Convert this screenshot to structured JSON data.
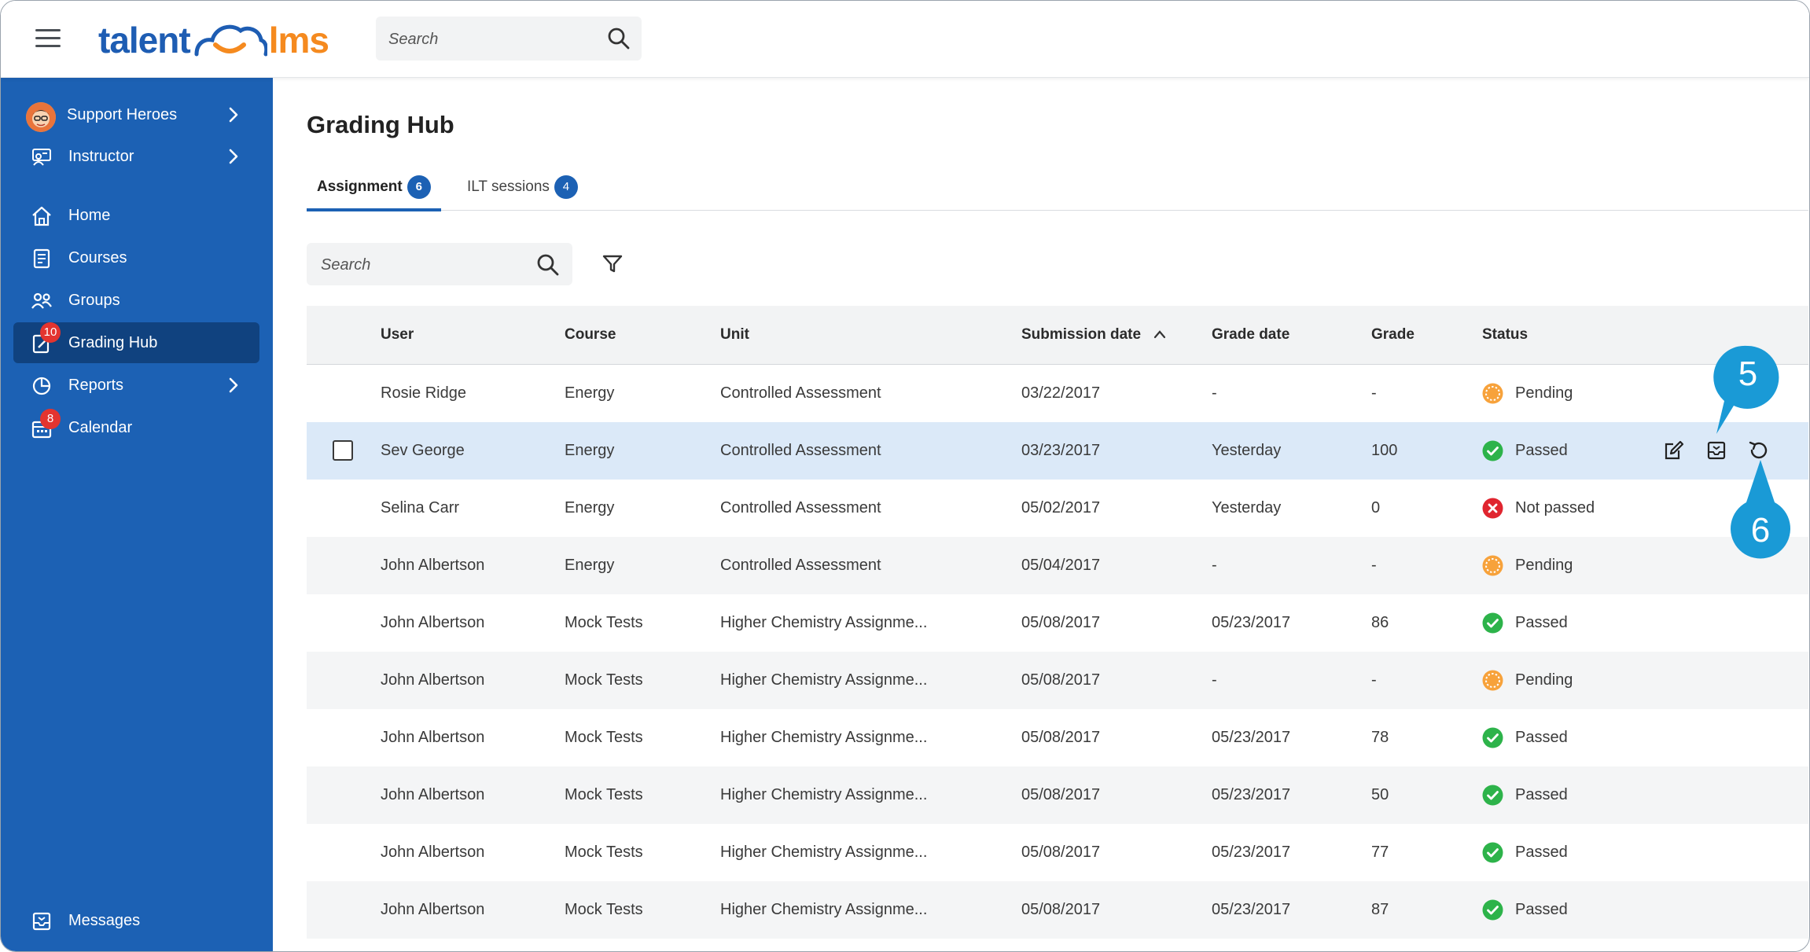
{
  "header": {
    "logo_part1": "talent",
    "logo_part2": "lms",
    "search_placeholder": "Search"
  },
  "sidebar": {
    "items": [
      {
        "label": "Support Heroes",
        "icon": "avatar",
        "chevron": true
      },
      {
        "label": "Instructor",
        "icon": "instructor-icon",
        "chevron": true
      },
      {
        "label": "Home",
        "icon": "home-icon"
      },
      {
        "label": "Courses",
        "icon": "courses-icon"
      },
      {
        "label": "Groups",
        "icon": "groups-icon"
      },
      {
        "label": "Grading Hub",
        "icon": "grading-hub-icon",
        "badge": "10",
        "active": true
      },
      {
        "label": "Reports",
        "icon": "reports-icon",
        "chevron": true
      },
      {
        "label": "Calendar",
        "icon": "calendar-icon",
        "badge": "8"
      }
    ],
    "footer": {
      "label": "Messages",
      "icon": "messages-icon"
    }
  },
  "page": {
    "title": "Grading Hub",
    "tabs": [
      {
        "label": "Assignment",
        "count": "6",
        "active": true
      },
      {
        "label": "ILT sessions",
        "count": "4",
        "active": false
      }
    ],
    "search_placeholder": "Search"
  },
  "table": {
    "columns": [
      "User",
      "Course",
      "Unit",
      "Submission date",
      "Grade date",
      "Grade",
      "Status"
    ],
    "sort_indicator": "Submission date ascending",
    "rows": [
      {
        "user": "Rosie Ridge",
        "course": "Energy",
        "unit": "Controlled Assessment",
        "submission": "03/22/2017",
        "grade_date": "-",
        "grade": "-",
        "status": "Pending"
      },
      {
        "user": "Sev George",
        "course": "Energy",
        "unit": "Controlled Assessment",
        "submission": "03/23/2017",
        "grade_date": "Yesterday",
        "grade": "100",
        "status": "Passed",
        "selected": true
      },
      {
        "user": "Selina Carr",
        "course": "Energy",
        "unit": "Controlled Assessment",
        "submission": "05/02/2017",
        "grade_date": "Yesterday",
        "grade": "0",
        "status": "Not passed"
      },
      {
        "user": "John Albertson",
        "course": "Energy",
        "unit": "Controlled Assessment",
        "submission": "05/04/2017",
        "grade_date": "-",
        "grade": "-",
        "status": "Pending"
      },
      {
        "user": "John Albertson",
        "course": "Mock Tests",
        "unit": "Higher Chemistry Assignme...",
        "submission": "05/08/2017",
        "grade_date": "05/23/2017",
        "grade": "86",
        "status": "Passed"
      },
      {
        "user": "John Albertson",
        "course": "Mock Tests",
        "unit": "Higher Chemistry Assignme...",
        "submission": "05/08/2017",
        "grade_date": "-",
        "grade": "-",
        "status": "Pending"
      },
      {
        "user": "John Albertson",
        "course": "Mock Tests",
        "unit": "Higher Chemistry Assignme...",
        "submission": "05/08/2017",
        "grade_date": "05/23/2017",
        "grade": "78",
        "status": "Passed"
      },
      {
        "user": "John Albertson",
        "course": "Mock Tests",
        "unit": "Higher Chemistry Assignme...",
        "submission": "05/08/2017",
        "grade_date": "05/23/2017",
        "grade": "50",
        "status": "Passed"
      },
      {
        "user": "John Albertson",
        "course": "Mock Tests",
        "unit": "Higher Chemistry Assignme...",
        "submission": "05/08/2017",
        "grade_date": "05/23/2017",
        "grade": "77",
        "status": "Passed"
      },
      {
        "user": "John Albertson",
        "course": "Mock Tests",
        "unit": "Higher Chemistry Assignme...",
        "submission": "05/08/2017",
        "grade_date": "05/23/2017",
        "grade": "87",
        "status": "Passed"
      }
    ],
    "row_actions": [
      "edit-icon",
      "inbox-icon",
      "reset-icon"
    ],
    "more_label": "···"
  },
  "callouts": [
    {
      "number": "5"
    },
    {
      "number": "6"
    }
  ],
  "colors": {
    "brand_blue": "#1c61b4",
    "sidebar_active": "#10427f",
    "logo_orange": "#f58a1f",
    "passed": "#2db34a",
    "not_passed": "#e0252f",
    "pending": "#f7a23b",
    "selected_row": "#dbe9f8",
    "callout": "#1a9ad6"
  }
}
